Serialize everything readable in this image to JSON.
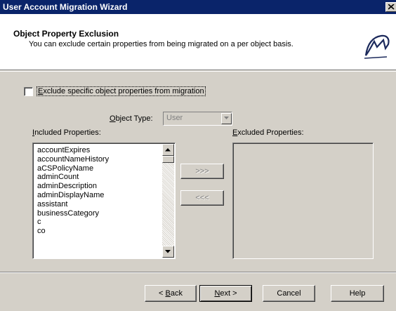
{
  "window": {
    "title": "User Account Migration Wizard"
  },
  "header": {
    "title": "Object Property Exclusion",
    "description": "You can exclude certain properties from being migrated on a per object basis."
  },
  "exclude_checkbox": {
    "label_prefix": "",
    "label_mnemonic": "E",
    "label_rest": "xclude specific object properties from migration",
    "checked": false
  },
  "object_type": {
    "label_mnemonic": "O",
    "label_rest": "bject Type:",
    "value": "User"
  },
  "included": {
    "label_mnemonic": "I",
    "label_rest": "ncluded Properties:",
    "items": [
      "accountExpires",
      "accountNameHistory",
      "aCSPolicyName",
      "adminCount",
      "adminDescription",
      "adminDisplayName",
      "assistant",
      "businessCategory",
      "c",
      "co"
    ]
  },
  "excluded": {
    "label_mnemonic": "E",
    "label_rest": "xcluded Properties:",
    "items": []
  },
  "move_buttons": {
    "right_label": ">>>",
    "left_label": "<<<"
  },
  "footer": {
    "back_prefix": "< ",
    "back_mnemonic": "B",
    "back_rest": "ack",
    "next_mnemonic": "N",
    "next_rest": "ext >",
    "cancel": "Cancel",
    "help": "Help"
  },
  "icons": {
    "close": "close-icon",
    "wizard_logo": "wizard-logo-icon",
    "dropdown": "chevron-down-icon",
    "scroll_up": "scroll-up-arrow-icon",
    "scroll_down": "scroll-down-arrow-icon"
  }
}
